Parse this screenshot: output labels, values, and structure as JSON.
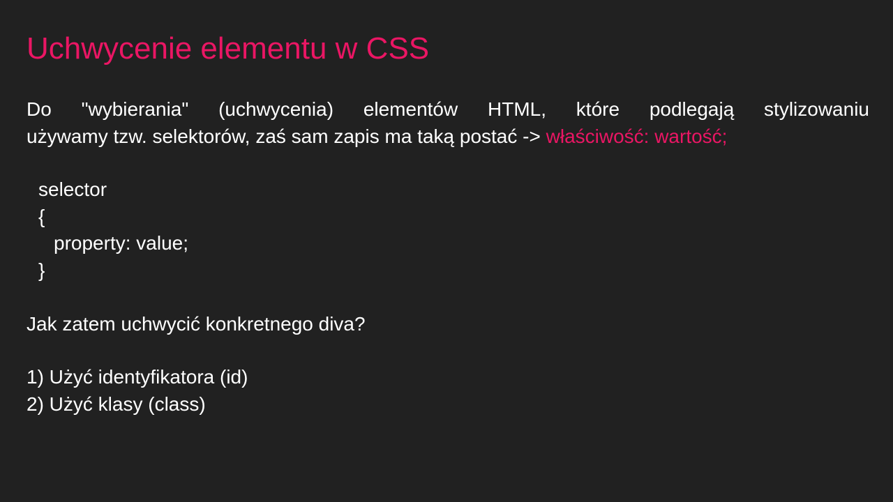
{
  "slide": {
    "title": "Uchwycenie elementu w CSS",
    "intro_line1": "Do \"wybierania\" (uchwycenia) elementów HTML, które podlegają stylizowaniu",
    "intro_line2_prefix": "używamy tzw. selektorów, zaś sam zapis ma taką postać -> ",
    "intro_highlight": "właściwość: wartość;",
    "code": {
      "line1": "selector",
      "line2": "{",
      "line3": "property: value;",
      "line4": "}"
    },
    "question": "Jak zatem uchwycić konkretnego diva?",
    "options": [
      "1) Użyć identyfikatora (id)",
      "2) Użyć klasy (class)"
    ],
    "colors": {
      "background": "#212121",
      "accent": "#ea1664",
      "text": "#ffffff"
    }
  }
}
